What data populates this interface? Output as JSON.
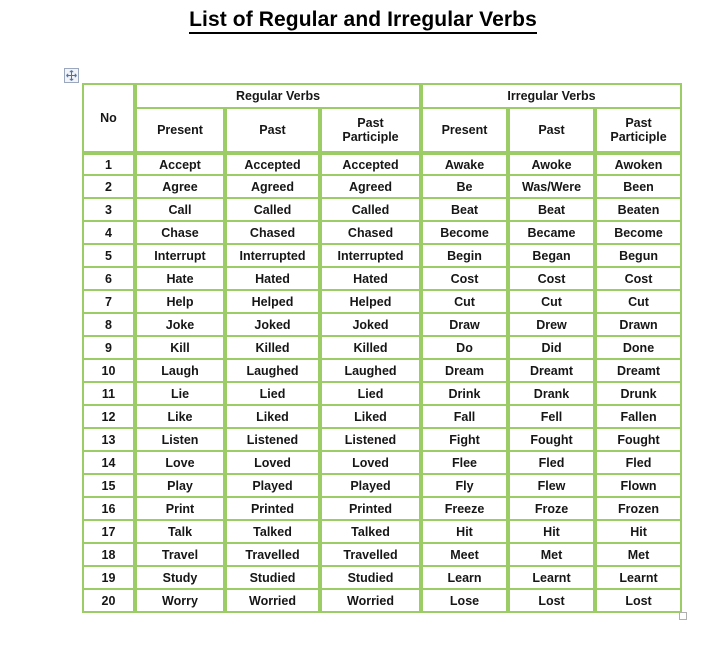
{
  "document": {
    "title": "List of Regular and Irregular Verbs"
  },
  "handles": {
    "move_handle_icon": "move-cross-icon",
    "resize_handle_icon": "resize-square-icon"
  },
  "colors": {
    "header_fill": "#f6c79c",
    "border": "#9ccc65",
    "cell_fill": "#ffffff",
    "text": "#161616",
    "page_background": "#ffffff"
  },
  "table": {
    "no_column_header": "No",
    "group_headers": [
      {
        "label": "Regular Verbs",
        "span": 3
      },
      {
        "label": "Irregular Verbs",
        "span": 3
      }
    ],
    "sub_headers": [
      "Present",
      "Past",
      "Past Participle",
      "Present",
      "Past",
      "Past Participle"
    ],
    "sub_headers_split": [
      {
        "line1": "Present",
        "line2": ""
      },
      {
        "line1": "Past",
        "line2": ""
      },
      {
        "line1": "Past",
        "line2": "Participle"
      },
      {
        "line1": "Present",
        "line2": ""
      },
      {
        "line1": "Past",
        "line2": ""
      },
      {
        "line1": "Past",
        "line2": "Participle"
      }
    ],
    "rows": [
      {
        "no": "1",
        "reg_present": "Accept",
        "reg_past": "Accepted",
        "reg_pp": "Accepted",
        "irr_present": "Awake",
        "irr_past": "Awoke",
        "irr_pp": "Awoken"
      },
      {
        "no": "2",
        "reg_present": "Agree",
        "reg_past": "Agreed",
        "reg_pp": "Agreed",
        "irr_present": "Be",
        "irr_past": "Was/Were",
        "irr_pp": "Been"
      },
      {
        "no": "3",
        "reg_present": "Call",
        "reg_past": "Called",
        "reg_pp": "Called",
        "irr_present": "Beat",
        "irr_past": "Beat",
        "irr_pp": "Beaten"
      },
      {
        "no": "4",
        "reg_present": "Chase",
        "reg_past": "Chased",
        "reg_pp": "Chased",
        "irr_present": "Become",
        "irr_past": "Became",
        "irr_pp": "Become"
      },
      {
        "no": "5",
        "reg_present": "Interrupt",
        "reg_past": "Interrupted",
        "reg_pp": "Interrupted",
        "irr_present": "Begin",
        "irr_past": "Began",
        "irr_pp": "Begun"
      },
      {
        "no": "6",
        "reg_present": "Hate",
        "reg_past": "Hated",
        "reg_pp": "Hated",
        "irr_present": "Cost",
        "irr_past": "Cost",
        "irr_pp": "Cost"
      },
      {
        "no": "7",
        "reg_present": "Help",
        "reg_past": "Helped",
        "reg_pp": "Helped",
        "irr_present": "Cut",
        "irr_past": "Cut",
        "irr_pp": "Cut"
      },
      {
        "no": "8",
        "reg_present": "Joke",
        "reg_past": "Joked",
        "reg_pp": "Joked",
        "irr_present": "Draw",
        "irr_past": "Drew",
        "irr_pp": "Drawn"
      },
      {
        "no": "9",
        "reg_present": "Kill",
        "reg_past": "Killed",
        "reg_pp": "Killed",
        "irr_present": "Do",
        "irr_past": "Did",
        "irr_pp": "Done"
      },
      {
        "no": "10",
        "reg_present": "Laugh",
        "reg_past": "Laughed",
        "reg_pp": "Laughed",
        "irr_present": "Dream",
        "irr_past": "Dreamt",
        "irr_pp": "Dreamt"
      },
      {
        "no": "11",
        "reg_present": "Lie",
        "reg_past": "Lied",
        "reg_pp": "Lied",
        "irr_present": "Drink",
        "irr_past": "Drank",
        "irr_pp": "Drunk"
      },
      {
        "no": "12",
        "reg_present": "Like",
        "reg_past": "Liked",
        "reg_pp": "Liked",
        "irr_present": "Fall",
        "irr_past": "Fell",
        "irr_pp": "Fallen"
      },
      {
        "no": "13",
        "reg_present": "Listen",
        "reg_past": "Listened",
        "reg_pp": "Listened",
        "irr_present": "Fight",
        "irr_past": "Fought",
        "irr_pp": "Fought"
      },
      {
        "no": "14",
        "reg_present": "Love",
        "reg_past": "Loved",
        "reg_pp": "Loved",
        "irr_present": "Flee",
        "irr_past": "Fled",
        "irr_pp": "Fled"
      },
      {
        "no": "15",
        "reg_present": "Play",
        "reg_past": "Played",
        "reg_pp": "Played",
        "irr_present": "Fly",
        "irr_past": "Flew",
        "irr_pp": "Flown"
      },
      {
        "no": "16",
        "reg_present": "Print",
        "reg_past": "Printed",
        "reg_pp": "Printed",
        "irr_present": "Freeze",
        "irr_past": "Froze",
        "irr_pp": "Frozen"
      },
      {
        "no": "17",
        "reg_present": "Talk",
        "reg_past": "Talked",
        "reg_pp": "Talked",
        "irr_present": "Hit",
        "irr_past": "Hit",
        "irr_pp": "Hit"
      },
      {
        "no": "18",
        "reg_present": "Travel",
        "reg_past": "Travelled",
        "reg_pp": "Travelled",
        "irr_present": "Meet",
        "irr_past": "Met",
        "irr_pp": "Met"
      },
      {
        "no": "19",
        "reg_present": "Study",
        "reg_past": "Studied",
        "reg_pp": "Studied",
        "irr_present": "Learn",
        "irr_past": "Learnt",
        "irr_pp": "Learnt"
      },
      {
        "no": "20",
        "reg_present": "Worry",
        "reg_past": "Worried",
        "reg_pp": "Worried",
        "irr_present": "Lose",
        "irr_past": "Lost",
        "irr_pp": "Lost"
      }
    ]
  }
}
